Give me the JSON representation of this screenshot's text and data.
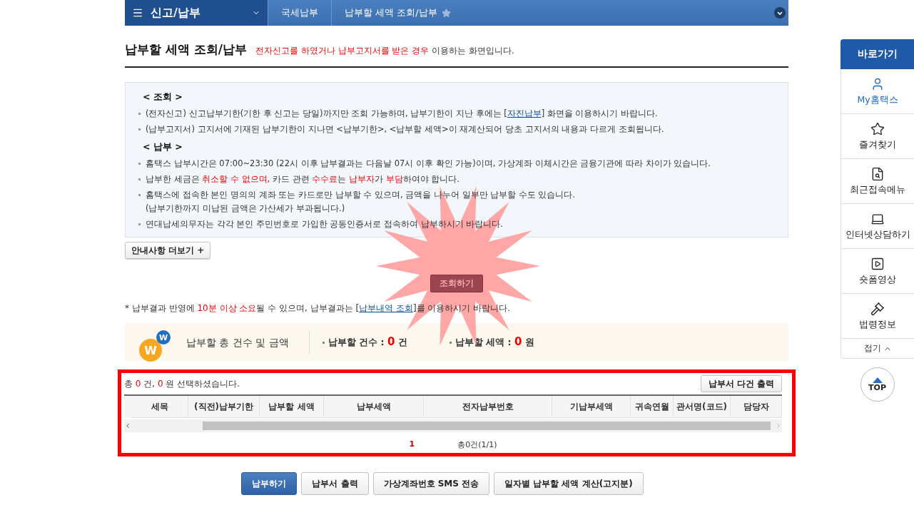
{
  "header": {
    "menu_title": "신고/납부",
    "breadcrumbs": [
      {
        "label": "국세납부"
      },
      {
        "label": "납부할 세액 조회/납부",
        "starred": false
      }
    ]
  },
  "page": {
    "title": "납부할 세액 조회/납부",
    "description": [
      {
        "kind": "red",
        "text": "전자신고를 하였거나 납부고지서를 받은 경우"
      },
      {
        "kind": "plain",
        "text": " 이용하는 화면입니다."
      }
    ]
  },
  "info": {
    "sections": [
      {
        "heading": "< 조회 >",
        "items": [
          {
            "segments": [
              {
                "kind": "plain",
                "text": "(전자신고) 신고납부기한(기한 후 신고는 당일)까지만 조회 가능하며, 납부기한이 지난 후에는 ["
              },
              {
                "kind": "link",
                "text": "자진납부"
              },
              {
                "kind": "plain",
                "text": "] 화면을 이용하시기 바랍니다."
              }
            ]
          },
          {
            "segments": [
              {
                "kind": "plain",
                "text": "(납부고지서) 고지서에 기재된 납부기한이 지나면 <납부기한>, <납부할 세액>이 재계산되어 당초 고지서의 내용과 다르게 조회됩니다."
              }
            ]
          }
        ]
      },
      {
        "heading": "< 납부 >",
        "items": [
          {
            "segments": [
              {
                "kind": "plain",
                "text": "홈택스 납부시간은 07:00~23:30 (22시 이후 납부결과는 다음날 07시 이후 확인 가능)이며, 가상계좌 이체시간은 금융기관에 따라 차이가 있습니다."
              }
            ]
          },
          {
            "segments": [
              {
                "kind": "plain",
                "text": "납부한 세금은 "
              },
              {
                "kind": "red",
                "text": "취소할 수 없으며,"
              },
              {
                "kind": "plain",
                "text": " 카드 관련 "
              },
              {
                "kind": "red",
                "text": "수수료"
              },
              {
                "kind": "plain",
                "text": "는 "
              },
              {
                "kind": "red",
                "text": "납부자"
              },
              {
                "kind": "plain",
                "text": "가 "
              },
              {
                "kind": "red",
                "text": "부담"
              },
              {
                "kind": "plain",
                "text": "하여야 합니다."
              }
            ]
          },
          {
            "segments": [
              {
                "kind": "plain",
                "text": "홈택스에 접속한 본인 명의의 계좌 또는 카드로만 납부할 수 있으며, 금액을 나누어 일부만 납부할 수도 있습니다."
              }
            ],
            "subline": "(납부기한까지 미납된 금액은 가산세가 부과됩니다.)"
          },
          {
            "segments": [
              {
                "kind": "plain",
                "text": "연대납세의무자는 각각 본인 주민번호로 가입한 공동인증서로 접속하여 납부하시기 바랍니다."
              }
            ]
          }
        ]
      }
    ],
    "more_button": "안내사항 더보기 +"
  },
  "query_button": "조회하기",
  "notice": [
    {
      "kind": "plain",
      "text": "* 납부결과 반영에 "
    },
    {
      "kind": "red",
      "text": "10분 이상 소요"
    },
    {
      "kind": "plain",
      "text": "될 수 있으며, 납부결과는 ["
    },
    {
      "kind": "link",
      "text": "납부내역 조회"
    },
    {
      "kind": "plain",
      "text": "]를 이용하시기 바랍니다."
    }
  ],
  "summary": {
    "logo_letters": [
      "W",
      "W"
    ],
    "title": "납부할 총 건수 및 금액",
    "stats": [
      {
        "label": "납부할 건수 :",
        "value": "0",
        "unit": "건"
      },
      {
        "label": "납부할 세액 :",
        "value": "0",
        "unit": "원"
      }
    ]
  },
  "selection": [
    {
      "kind": "plain",
      "text": "총 "
    },
    {
      "kind": "red",
      "text": "0"
    },
    {
      "kind": "plain",
      "text": " 건, "
    },
    {
      "kind": "red",
      "text": "0"
    },
    {
      "kind": "plain",
      "text": " 원 선택하셨습니다."
    }
  ],
  "print_button": "납부서 다건 출력",
  "table": {
    "columns": [
      "세목",
      "(직전)납부기한",
      "납부할 세액",
      "납부세액",
      "전자납부번호",
      "기납부세액",
      "귀속연월",
      "관서명(코드)",
      "담당자"
    ]
  },
  "pagination": {
    "page": "1",
    "total": "총0건(1/1)"
  },
  "buttons": [
    {
      "label": "납부하기",
      "kind": "primary"
    },
    {
      "label": "납부서 출력",
      "kind": "default"
    },
    {
      "label": "가상계좌번호 SMS 전송",
      "kind": "default"
    },
    {
      "label": "일자별 납부할 세액 계산(고지분)",
      "kind": "default"
    }
  ],
  "sidebar": {
    "title": "바로가기",
    "items": [
      {
        "label": "My홈택스",
        "selected": true
      },
      {
        "label": "즐겨찾기",
        "selected": false
      },
      {
        "label": "최근접속메뉴",
        "selected": false
      },
      {
        "label": "인터넷상담하기",
        "selected": false
      },
      {
        "label": "숏폼영상",
        "selected": false
      },
      {
        "label": "법령정보",
        "selected": false
      }
    ],
    "fold": "접기",
    "top": "TOP"
  }
}
